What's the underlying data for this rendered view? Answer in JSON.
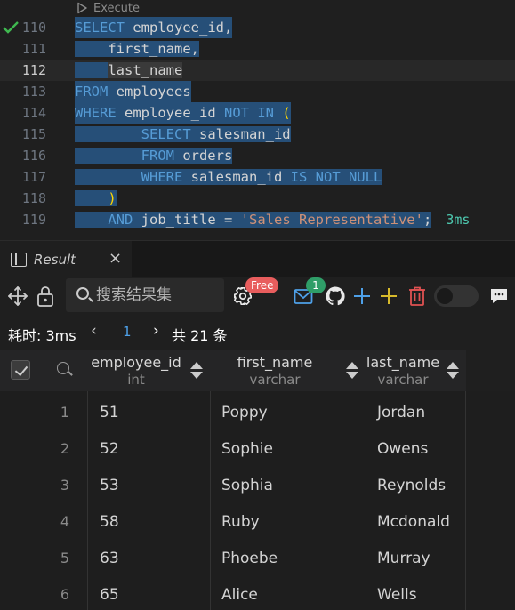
{
  "editor": {
    "codelens_label": "Execute",
    "lines": [
      {
        "num": "110"
      },
      {
        "num": "111"
      },
      {
        "num": "112"
      },
      {
        "num": "113"
      },
      {
        "num": "114"
      },
      {
        "num": "115"
      },
      {
        "num": "116"
      },
      {
        "num": "117"
      },
      {
        "num": "118"
      },
      {
        "num": "119"
      }
    ],
    "tokens": {
      "select": "SELECT",
      "employee_id_comma": " employee_id,",
      "first_name": "first_name,",
      "last_name": "last_name",
      "from": "FROM",
      "employees": " employees",
      "where": "WHERE",
      "employee_id": " employee_id ",
      "not_in": "NOT IN",
      "open_paren": "(",
      "select2": "SELECT",
      "salesman_id": " salesman_id",
      "from2": "FROM",
      "orders": " orders",
      "where2": "WHERE",
      "salesman_id2": " salesman_id ",
      "is_not_null": "IS NOT NULL",
      "close_paren": ")",
      "and": "AND",
      "job_title": " job_title ",
      "eq": "=",
      "str": "'Sales Representative'",
      "semi": ";"
    },
    "exec_time": "3ms"
  },
  "panel": {
    "tab_label": "Result",
    "close_glyph": "×",
    "search_placeholder": "搜索结果集",
    "free_badge": "Free",
    "mail_count": "1"
  },
  "status": {
    "elapsed": "耗时: 3ms",
    "prev": "‹",
    "page": "1",
    "next": "›",
    "total": "共 21 条"
  },
  "grid": {
    "columns": [
      {
        "name": "employee_id",
        "type": "int"
      },
      {
        "name": "first_name",
        "type": "varchar"
      },
      {
        "name": "last_name",
        "type": "varchar"
      }
    ],
    "rows": [
      {
        "n": "1",
        "employee_id": "51",
        "first_name": "Poppy",
        "last_name": "Jordan"
      },
      {
        "n": "2",
        "employee_id": "52",
        "first_name": "Sophie",
        "last_name": "Owens"
      },
      {
        "n": "3",
        "employee_id": "53",
        "first_name": "Sophia",
        "last_name": "Reynolds"
      },
      {
        "n": "4",
        "employee_id": "58",
        "first_name": "Ruby",
        "last_name": "Mcdonald"
      },
      {
        "n": "5",
        "employee_id": "63",
        "first_name": "Phoebe",
        "last_name": "Murray"
      },
      {
        "n": "6",
        "employee_id": "65",
        "first_name": "Alice",
        "last_name": "Wells"
      }
    ]
  },
  "colors": {
    "keyword": "#569cd6",
    "string": "#ce9178",
    "selection": "#264f78",
    "accent_blue": "#4ea0e8",
    "free_badge": "#e85d5d",
    "mail_badge": "#2f9e68"
  },
  "icons": {
    "gutter": "check-icon",
    "codelens": "play-icon",
    "tab": "panel-icon",
    "toolbar": [
      "move-icon",
      "lock-icon",
      "search-icon",
      "gear-icon",
      "mail-icon",
      "github-icon",
      "plus-icon",
      "plus-yellow-icon",
      "trash-icon",
      "toggle-switch",
      "chat-icon"
    ]
  }
}
